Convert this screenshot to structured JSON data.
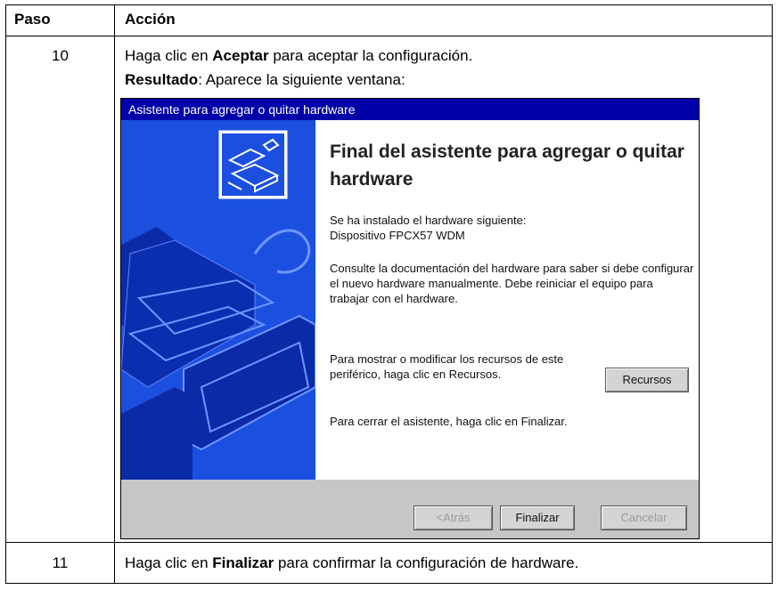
{
  "table": {
    "header": {
      "paso": "Paso",
      "accion": "Acción"
    },
    "rows": [
      {
        "step": "10",
        "line1_pre": "Haga clic en ",
        "line1_bold": "Aceptar",
        "line1_post": " para aceptar la configuración.",
        "line2_bold": "Resultado",
        "line2_post": ": Aparece la siguiente ventana:"
      },
      {
        "step": "11",
        "pre": "Haga clic en ",
        "bold": "Finalizar",
        "post": " para confirmar la configuración de hardware."
      }
    ]
  },
  "wizard": {
    "title": "Asistente para agregar o quitar hardware",
    "heading": "Final del asistente para agregar o quitar hardware",
    "installed_label": "Se ha instalado el hardware siguiente:",
    "device_name": "Dispositivo FPCX57 WDM",
    "consult_text": "Consulte la documentación del hardware para saber si debe configurar el nuevo hardware manualmente.  Debe reiniciar el equipo para trabajar con el hardware.",
    "resources_text": "Para mostrar o modificar los recursos de este periférico, haga clic en Recursos.",
    "resources_button": "Recursos",
    "close_text": "Para cerrar el asistente, haga clic en Finalizar.",
    "buttons": {
      "back": "<Atrás",
      "finish": "Finalizar",
      "cancel": "Cancelar"
    },
    "colors": {
      "titlebar": "#0000a8",
      "side_panel": "#1b4fe0",
      "footer": "#c6c6c6"
    }
  }
}
